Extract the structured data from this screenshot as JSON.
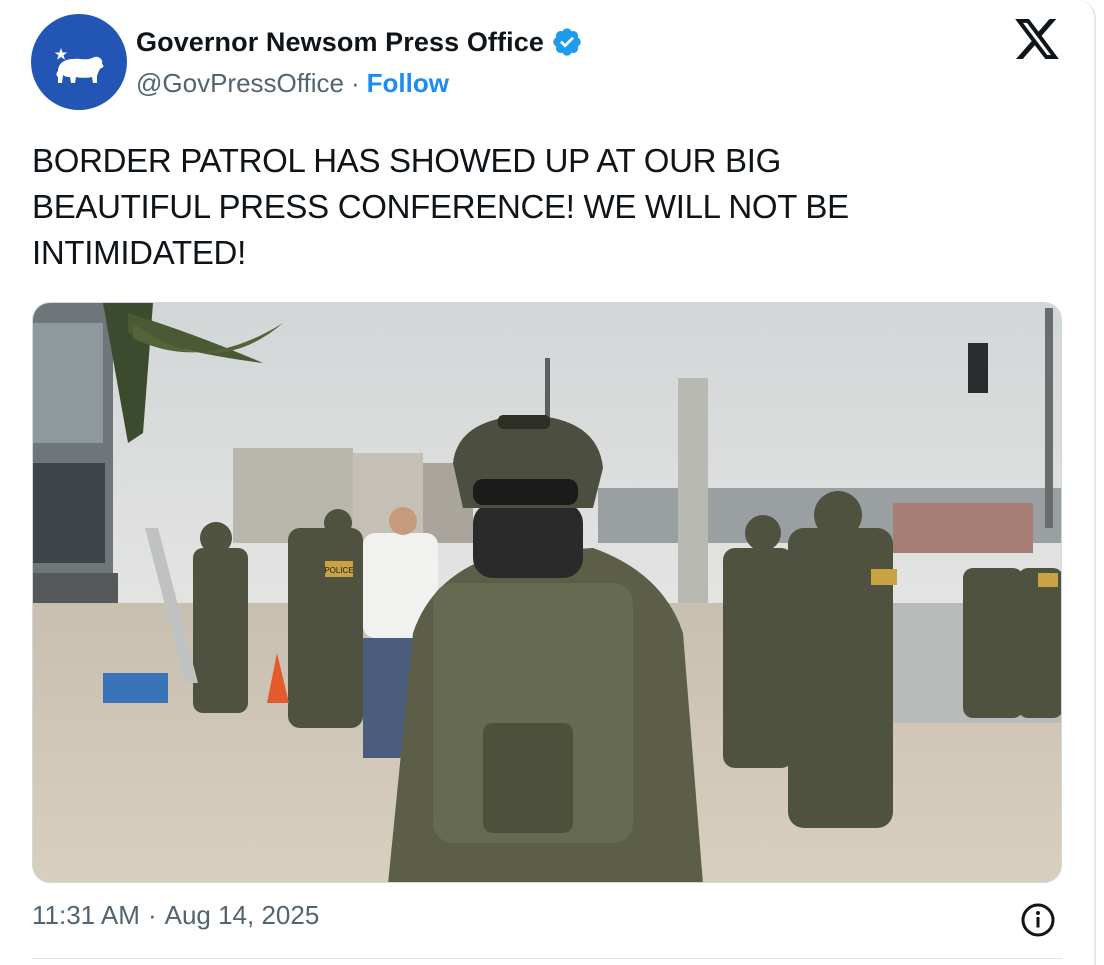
{
  "author": {
    "display_name": "Governor Newsom Press Office",
    "handle": "@GovPressOffice",
    "separator": "·",
    "follow_label": "Follow",
    "avatar_icon": "california-bear-flag-icon",
    "verified_icon": "verified-badge-icon"
  },
  "tweet": {
    "text": "BORDER PATROL HAS SHOWED UP AT OUR BIG\nBEAUTIFUL PRESS CONFERENCE! WE WILL NOT BE\nINTIMIDATED!",
    "media_description_icon": "photo-image"
  },
  "media_labels": {
    "vest_patch": "POLICE"
  },
  "footer": {
    "time": "11:31 AM",
    "separator": "·",
    "date": "Aug 14, 2025",
    "info_icon": "info-icon"
  },
  "brand": {
    "x_logo": "x-logo-icon"
  },
  "colors": {
    "accent": "#1d8bf0",
    "secondary_text": "#536471",
    "avatar_bg": "#2356b4"
  }
}
